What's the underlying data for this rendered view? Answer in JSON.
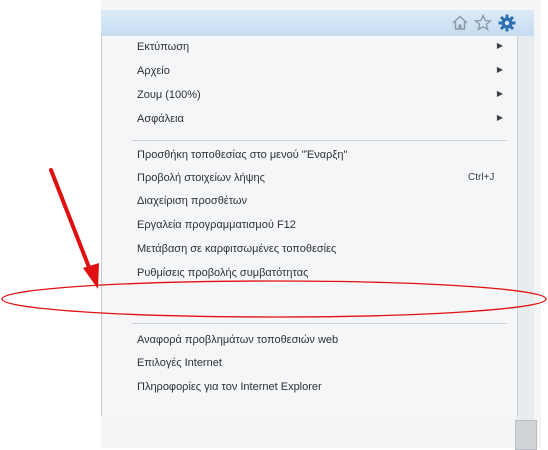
{
  "toolbar": {
    "icons": [
      "home-icon",
      "favorites-star-icon",
      "tools-gear-icon"
    ]
  },
  "menu": {
    "group1": [
      {
        "label": "Εκτύπωση",
        "has_submenu": true
      },
      {
        "label": "Αρχείο",
        "has_submenu": true
      },
      {
        "label": "Ζουμ (100%)",
        "has_submenu": true
      },
      {
        "label": "Ασφάλεια",
        "has_submenu": true
      }
    ],
    "group2": [
      {
        "label": "Προσθήκη τοποθεσίας στο μενού \"Έναρξη\""
      },
      {
        "label": "Προβολή στοιχείων λήψης",
        "shortcut": "Ctrl+J"
      },
      {
        "label": "Διαχείριση προσθέτων"
      },
      {
        "label": "Εργαλεία προγραμματισμού F12"
      },
      {
        "label": "Μετάβαση σε καρφιτσωμένες τοποθεσίες"
      },
      {
        "label": "Ρυθμίσεις προβολής συμβατότητας",
        "highlighted_by_annotation": true
      }
    ],
    "group3": [
      {
        "label": "Αναφορά προβλημάτων τοποθεσιών web"
      },
      {
        "label": "Επιλογές Internet"
      },
      {
        "label": "Πληροφορίες για τον Internet Explorer"
      }
    ]
  },
  "annotation": {
    "arrow_color": "#e01010",
    "ellipse_color": "#e01010",
    "target_item": "Ρυθμίσεις προβολής συμβατότητας"
  },
  "colors": {
    "toolbar_top": "#dcebf8",
    "toolbar_bottom": "#c6dcf1",
    "menu_background": "#f5f6f7",
    "menu_text": "#2c3137",
    "gear_blue": "#2f6fb3"
  }
}
